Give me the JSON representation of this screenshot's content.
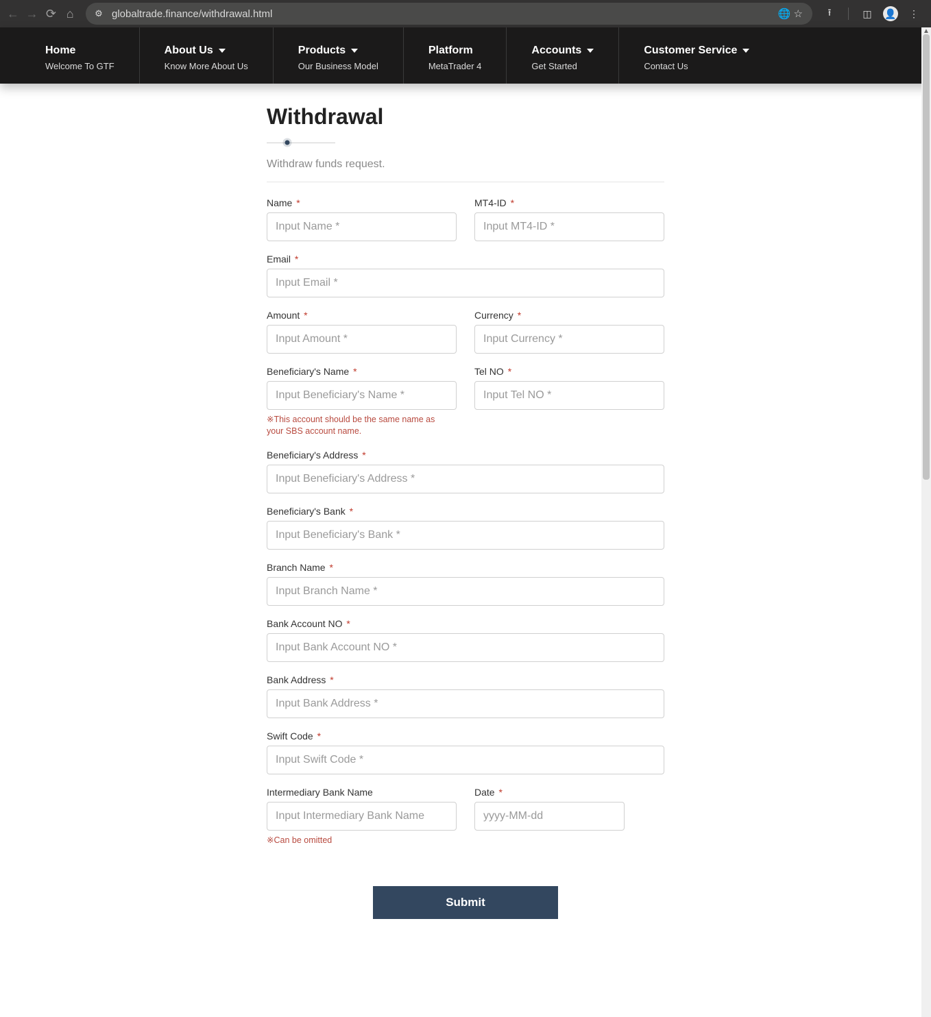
{
  "browser": {
    "url": "globaltrade.finance/withdrawal.html"
  },
  "nav": [
    {
      "title": "Home",
      "sub": "Welcome To GTF",
      "dropdown": false
    },
    {
      "title": "About Us",
      "sub": "Know More About Us",
      "dropdown": true
    },
    {
      "title": "Products",
      "sub": "Our Business Model",
      "dropdown": true
    },
    {
      "title": "Platform",
      "sub": "MetaTrader 4",
      "dropdown": false
    },
    {
      "title": "Accounts",
      "sub": "Get Started",
      "dropdown": true
    },
    {
      "title": "Customer Service",
      "sub": "Contact Us",
      "dropdown": true
    }
  ],
  "page": {
    "title": "Withdrawal",
    "subtitle": "Withdraw funds request.",
    "submit": "Submit"
  },
  "fields": {
    "name": {
      "label": "Name",
      "placeholder": "Input Name *"
    },
    "mt4": {
      "label": "MT4-ID",
      "placeholder": "Input MT4-ID *"
    },
    "email": {
      "label": "Email",
      "placeholder": "Input Email *"
    },
    "amount": {
      "label": "Amount",
      "placeholder": "Input Amount *"
    },
    "currency": {
      "label": "Currency",
      "placeholder": "Input Currency *"
    },
    "benname": {
      "label": "Beneficiary's Name",
      "placeholder": "Input Beneficiary's Name *",
      "note": "※This account should be the same name as your SBS account name."
    },
    "tel": {
      "label": "Tel NO",
      "placeholder": "Input Tel NO *"
    },
    "benaddr": {
      "label": "Beneficiary's Address",
      "placeholder": "Input Beneficiary's Address *"
    },
    "benbank": {
      "label": "Beneficiary's Bank",
      "placeholder": "Input Beneficiary's Bank *"
    },
    "branch": {
      "label": "Branch Name",
      "placeholder": "Input Branch Name *"
    },
    "acctno": {
      "label": "Bank Account NO",
      "placeholder": "Input Bank Account NO *"
    },
    "bankaddr": {
      "label": "Bank Address",
      "placeholder": "Input Bank Address *"
    },
    "swift": {
      "label": "Swift Code",
      "placeholder": "Input Swift Code *"
    },
    "interbank": {
      "label": "Intermediary Bank Name",
      "placeholder": "Input Intermediary Bank Name",
      "note": "※Can be omitted",
      "required": false
    },
    "date": {
      "label": "Date",
      "placeholder": "yyyy-MM-dd"
    }
  }
}
